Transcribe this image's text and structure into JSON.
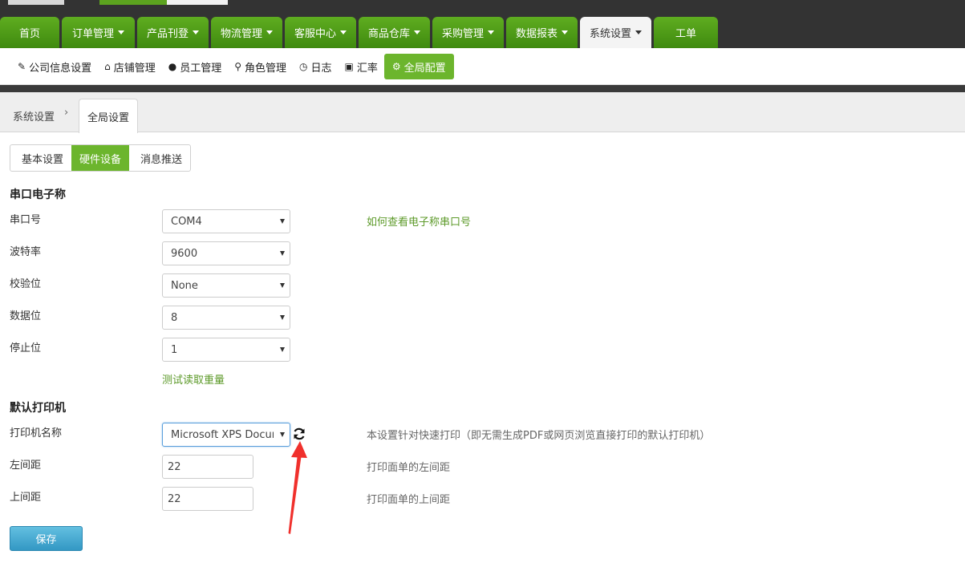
{
  "nav": {
    "tabs": [
      {
        "label": "首页",
        "dropdown": false
      },
      {
        "label": "订单管理",
        "dropdown": true
      },
      {
        "label": "产品刊登",
        "dropdown": true
      },
      {
        "label": "物流管理",
        "dropdown": true
      },
      {
        "label": "客服中心",
        "dropdown": true
      },
      {
        "label": "商品仓库",
        "dropdown": true
      },
      {
        "label": "采购管理",
        "dropdown": true
      },
      {
        "label": "数据报表",
        "dropdown": true
      },
      {
        "label": "系统设置",
        "dropdown": true,
        "active": true
      },
      {
        "label": "工单",
        "dropdown": false
      }
    ]
  },
  "subnav": {
    "items": [
      {
        "label": "公司信息设置",
        "icon": "edit-icon"
      },
      {
        "label": "店铺管理",
        "icon": "home-icon"
      },
      {
        "label": "员工管理",
        "icon": "user-icon"
      },
      {
        "label": "角色管理",
        "icon": "key-icon"
      },
      {
        "label": "日志",
        "icon": "clock-icon"
      },
      {
        "label": "汇率",
        "icon": "money-icon"
      },
      {
        "label": "全局配置",
        "icon": "gear-icon",
        "active": true
      }
    ]
  },
  "breadcrumb": {
    "root": "系统设置",
    "separator": "›",
    "current": "全局设置"
  },
  "settings_tabs": [
    {
      "label": "基本设置"
    },
    {
      "label": "硬件设备",
      "active": true
    },
    {
      "label": "消息推送"
    }
  ],
  "scale": {
    "title": "串口电子称",
    "port_label": "串口号",
    "port_value": "COM4",
    "port_help_link": "如何查看电子称串口号",
    "baud_label": "波特率",
    "baud_value": "9600",
    "parity_label": "校验位",
    "parity_value": "None",
    "databits_label": "数据位",
    "databits_value": "8",
    "stopbits_label": "停止位",
    "stopbits_value": "1",
    "test_link": "测试读取重量"
  },
  "printer": {
    "title": "默认打印机",
    "name_label": "打印机名称",
    "name_value": "Microsoft XPS Document Writer",
    "name_hint": "本设置针对快速打印（即无需生成PDF或网页浏览直接打印的默认打印机）",
    "left_label": "左间距",
    "left_value": "22",
    "left_hint": "打印面单的左间距",
    "top_label": "上间距",
    "top_value": "22",
    "top_hint": "打印面单的上间距"
  },
  "actions": {
    "save_label": "保存"
  },
  "colors": {
    "nav_green": "#5fad20",
    "active_green": "#6cb52d",
    "link_green": "#5d9a2a",
    "save_blue": "#3398c4",
    "arrow_red": "#f0302c"
  }
}
